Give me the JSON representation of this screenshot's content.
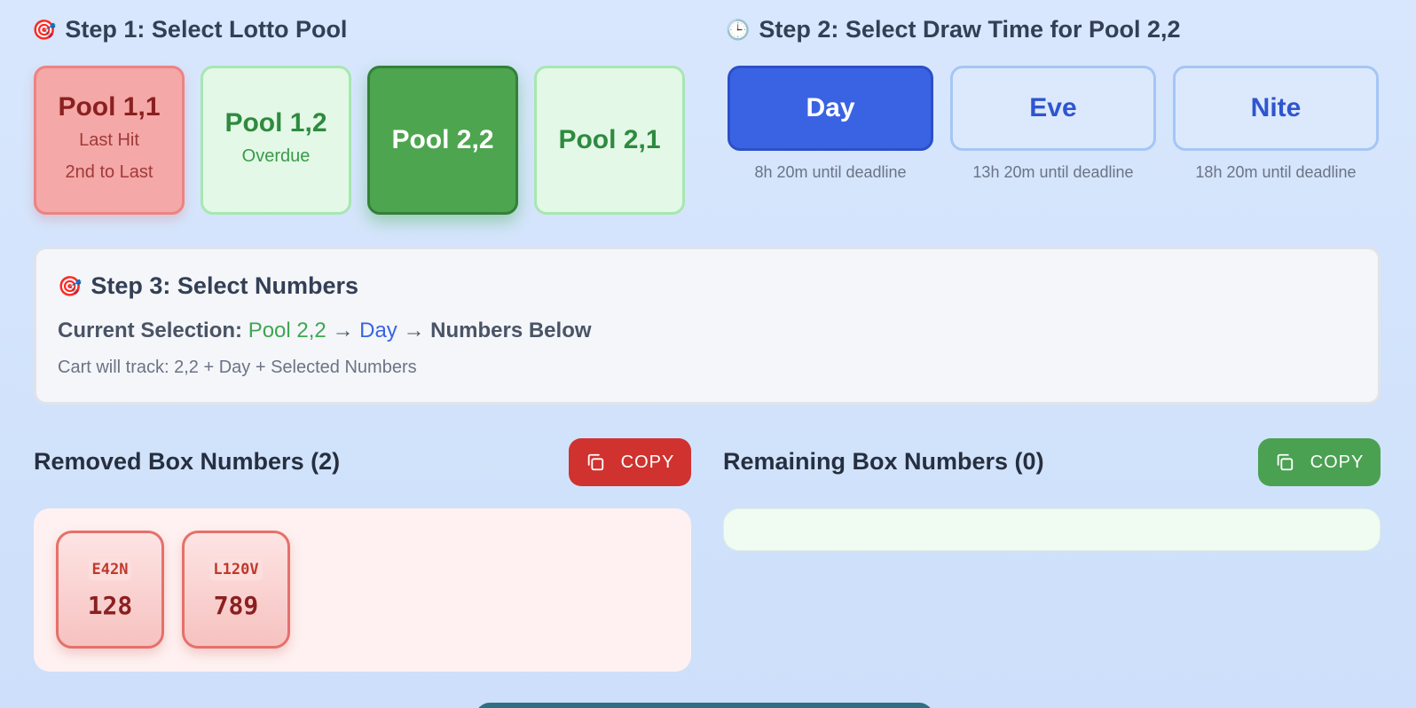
{
  "step1": {
    "icon": "🎯",
    "title": "Step 1: Select Lotto Pool",
    "pools": [
      {
        "name": "Pool 1,1",
        "sub1": "Last Hit",
        "sub2": "2nd to Last",
        "state": "last-hit"
      },
      {
        "name": "Pool 1,2",
        "sub1": "Overdue",
        "sub2": "",
        "state": "overdue"
      },
      {
        "name": "Pool 2,2",
        "sub1": "",
        "sub2": "",
        "state": "selected"
      },
      {
        "name": "Pool 2,1",
        "sub1": "",
        "sub2": "",
        "state": "normal"
      }
    ]
  },
  "step2": {
    "icon": "🕒",
    "title": "Step 2: Select Draw Time for Pool 2,2",
    "times": [
      {
        "label": "Day",
        "deadline": "8h 20m until deadline",
        "active": true
      },
      {
        "label": "Eve",
        "deadline": "13h 20m until deadline",
        "active": false
      },
      {
        "label": "Nite",
        "deadline": "18h 20m until deadline",
        "active": false
      }
    ]
  },
  "step3": {
    "icon": "🎯",
    "title": "Step 3: Select Numbers",
    "selection_prefix": "Current Selection:",
    "selection_pool": "Pool 2,2",
    "arrow": "→",
    "selection_time": "Day",
    "selection_suffix": "Numbers Below",
    "track": "Cart will track: 2,2 + Day + Selected Numbers"
  },
  "removed": {
    "title": "Removed Box Numbers (2)",
    "copy_label": "COPY",
    "items": [
      {
        "code": "E42N",
        "num": "128"
      },
      {
        "code": "L120V",
        "num": "789"
      }
    ]
  },
  "remaining": {
    "title": "Remaining Box Numbers (0)",
    "copy_label": "COPY",
    "items": []
  },
  "colors": {
    "accent_blue": "#3a63e4",
    "accent_green": "#4da54f",
    "alert_red": "#d0322f"
  }
}
